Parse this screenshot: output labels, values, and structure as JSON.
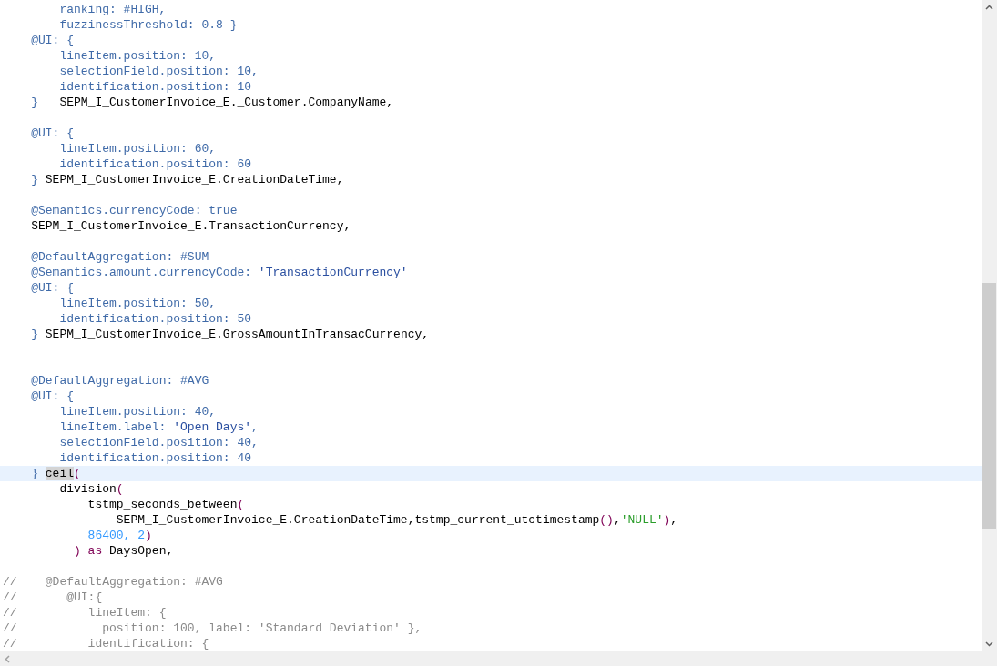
{
  "editor": {
    "lines": [
      {
        "kind": "code",
        "selected": false,
        "tokens": [
          {
            "text": "        ranking: #HIGH,",
            "kind": "annotation"
          }
        ]
      },
      {
        "kind": "code",
        "selected": false,
        "tokens": [
          {
            "text": "        fuzzinessThreshold: 0.8 }",
            "kind": "annotation"
          }
        ]
      },
      {
        "kind": "code",
        "selected": false,
        "tokens": [
          {
            "text": "    @UI: {",
            "kind": "annotation"
          }
        ]
      },
      {
        "kind": "code",
        "selected": false,
        "tokens": [
          {
            "text": "        lineItem.position: 10,",
            "kind": "annotation"
          }
        ]
      },
      {
        "kind": "code",
        "selected": false,
        "tokens": [
          {
            "text": "        selectionField.position: 10,",
            "kind": "annotation"
          }
        ]
      },
      {
        "kind": "code",
        "selected": false,
        "tokens": [
          {
            "text": "        identification.position: 10",
            "kind": "annotation"
          }
        ]
      },
      {
        "kind": "code",
        "selected": false,
        "tokens": [
          {
            "text": "    }   ",
            "kind": "annotation"
          },
          {
            "text": "SEPM_I_CustomerInvoice_E._Customer.CompanyName,",
            "kind": "plain"
          }
        ]
      },
      {
        "kind": "blank",
        "selected": false
      },
      {
        "kind": "code",
        "selected": false,
        "tokens": [
          {
            "text": "    @UI: {",
            "kind": "annotation"
          }
        ]
      },
      {
        "kind": "code",
        "selected": false,
        "tokens": [
          {
            "text": "        lineItem.position: 60,",
            "kind": "annotation"
          }
        ]
      },
      {
        "kind": "code",
        "selected": false,
        "tokens": [
          {
            "text": "        identification.position: 60",
            "kind": "annotation"
          }
        ]
      },
      {
        "kind": "code",
        "selected": false,
        "tokens": [
          {
            "text": "    } ",
            "kind": "annotation"
          },
          {
            "text": "SEPM_I_CustomerInvoice_E.CreationDateTime,",
            "kind": "plain"
          }
        ]
      },
      {
        "kind": "blank",
        "selected": false
      },
      {
        "kind": "code",
        "selected": false,
        "tokens": [
          {
            "text": "    @Semantics.currencyCode: true",
            "kind": "annotation"
          }
        ]
      },
      {
        "kind": "code",
        "selected": false,
        "tokens": [
          {
            "text": "    SEPM_I_CustomerInvoice_E.TransactionCurrency,",
            "kind": "plain"
          }
        ]
      },
      {
        "kind": "blank",
        "selected": false
      },
      {
        "kind": "code",
        "selected": false,
        "tokens": [
          {
            "text": "    @DefaultAggregation: #SUM",
            "kind": "annotation"
          }
        ]
      },
      {
        "kind": "code",
        "selected": false,
        "tokens": [
          {
            "text": "    @Semantics.amount.currencyCode: ",
            "kind": "annotation"
          },
          {
            "text": "'TransactionCurrency'",
            "kind": "string"
          }
        ]
      },
      {
        "kind": "code",
        "selected": false,
        "tokens": [
          {
            "text": "    @UI: {",
            "kind": "annotation"
          }
        ]
      },
      {
        "kind": "code",
        "selected": false,
        "tokens": [
          {
            "text": "        lineItem.position: 50,",
            "kind": "annotation"
          }
        ]
      },
      {
        "kind": "code",
        "selected": false,
        "tokens": [
          {
            "text": "        identification.position: 50",
            "kind": "annotation"
          }
        ]
      },
      {
        "kind": "code",
        "selected": false,
        "tokens": [
          {
            "text": "    } ",
            "kind": "annotation"
          },
          {
            "text": "SEPM_I_CustomerInvoice_E.GrossAmountInTransacCurrency,",
            "kind": "plain"
          }
        ]
      },
      {
        "kind": "blank",
        "selected": false
      },
      {
        "kind": "blank",
        "selected": false
      },
      {
        "kind": "code",
        "selected": false,
        "tokens": [
          {
            "text": "    @DefaultAggregation: #AVG",
            "kind": "annotation"
          }
        ]
      },
      {
        "kind": "code",
        "selected": false,
        "tokens": [
          {
            "text": "    @UI: {",
            "kind": "annotation"
          }
        ]
      },
      {
        "kind": "code",
        "selected": false,
        "tokens": [
          {
            "text": "        lineItem.position: 40,",
            "kind": "annotation"
          }
        ]
      },
      {
        "kind": "code",
        "selected": false,
        "tokens": [
          {
            "text": "        lineItem.label: ",
            "kind": "annotation"
          },
          {
            "text": "'Open Days'",
            "kind": "string"
          },
          {
            "text": ",",
            "kind": "annotation"
          }
        ]
      },
      {
        "kind": "code",
        "selected": false,
        "tokens": [
          {
            "text": "        selectionField.position: 40,",
            "kind": "annotation"
          }
        ]
      },
      {
        "kind": "code",
        "selected": false,
        "tokens": [
          {
            "text": "        identification.position: 40",
            "kind": "annotation"
          }
        ]
      },
      {
        "kind": "code",
        "selected": true,
        "tokens": [
          {
            "text": "    } ",
            "kind": "annotation"
          },
          {
            "text": "ceil",
            "kind": "match"
          },
          {
            "text": "(",
            "kind": "keyword"
          }
        ]
      },
      {
        "kind": "code",
        "selected": false,
        "tokens": [
          {
            "text": "        division",
            "kind": "plain"
          },
          {
            "text": "(",
            "kind": "keyword"
          }
        ]
      },
      {
        "kind": "code",
        "selected": false,
        "tokens": [
          {
            "text": "            tstmp_seconds_between",
            "kind": "plain"
          },
          {
            "text": "(",
            "kind": "keyword"
          }
        ]
      },
      {
        "kind": "code",
        "selected": false,
        "tokens": [
          {
            "text": "                SEPM_I_CustomerInvoice_E.CreationDateTime,tstmp_current_utctimestamp",
            "kind": "plain"
          },
          {
            "text": "()",
            "kind": "keyword"
          },
          {
            "text": ",",
            "kind": "plain"
          },
          {
            "text": "'NULL'",
            "kind": "literal"
          },
          {
            "text": ")",
            "kind": "keyword"
          },
          {
            "text": ",",
            "kind": "plain"
          }
        ]
      },
      {
        "kind": "code",
        "selected": false,
        "tokens": [
          {
            "text": "            86400, 2",
            "kind": "number"
          },
          {
            "text": ")",
            "kind": "keyword"
          }
        ]
      },
      {
        "kind": "code",
        "selected": false,
        "tokens": [
          {
            "text": "          ) as",
            "kind": "keyword"
          },
          {
            "text": " DaysOpen,",
            "kind": "plain"
          }
        ]
      },
      {
        "kind": "blank",
        "selected": false
      },
      {
        "kind": "code",
        "selected": false,
        "tokens": [
          {
            "text": "//    @DefaultAggregation: #AVG",
            "kind": "comment"
          }
        ]
      },
      {
        "kind": "code",
        "selected": false,
        "tokens": [
          {
            "text": "//       @UI:{",
            "kind": "comment"
          }
        ]
      },
      {
        "kind": "code",
        "selected": false,
        "tokens": [
          {
            "text": "//          lineItem: {",
            "kind": "comment"
          }
        ]
      },
      {
        "kind": "code",
        "selected": false,
        "tokens": [
          {
            "text": "//            position: 100, label: 'Standard Deviation' },",
            "kind": "comment"
          }
        ]
      },
      {
        "kind": "code",
        "selected": false,
        "tokens": [
          {
            "text": "//          identification: {",
            "kind": "comment"
          }
        ]
      }
    ]
  }
}
